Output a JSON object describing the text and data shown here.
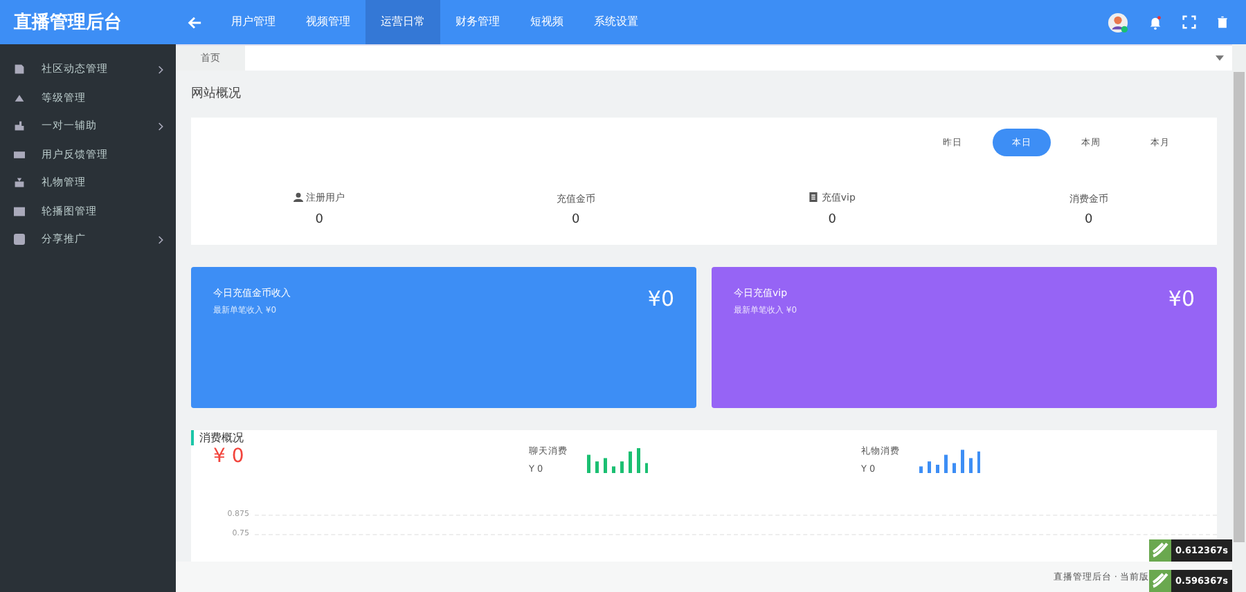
{
  "brand": "直播管理后台",
  "nav": [
    {
      "label": "用户管理",
      "selected": false
    },
    {
      "label": "视频管理",
      "selected": false
    },
    {
      "label": "运营日常",
      "selected": true
    },
    {
      "label": "财务管理",
      "selected": false
    },
    {
      "label": "短视频",
      "selected": false
    },
    {
      "label": "系统设置",
      "selected": false
    }
  ],
  "sidebar": [
    {
      "label": "社区动态管理",
      "kind": "doc",
      "has_children": true
    },
    {
      "label": "等级管理",
      "kind": "tri",
      "has_children": false
    },
    {
      "label": "一对一辅助",
      "kind": "hand",
      "has_children": true
    },
    {
      "label": "用户反馈管理",
      "kind": "list",
      "has_children": false
    },
    {
      "label": "礼物管理",
      "kind": "gift",
      "has_children": false
    },
    {
      "label": "轮播图管理",
      "kind": "image",
      "has_children": false
    },
    {
      "label": "分享推广",
      "kind": "share",
      "has_children": true
    }
  ],
  "tabs": [
    {
      "label": "首页",
      "selected": true
    }
  ],
  "section_title": "网站概况",
  "periods": [
    {
      "label": "昨日",
      "selected": false
    },
    {
      "label": "本日",
      "selected": true
    },
    {
      "label": "本周",
      "selected": false
    },
    {
      "label": "本月",
      "selected": false
    }
  ],
  "stats": [
    {
      "label": "注册用户",
      "value": "0",
      "kind": "user"
    },
    {
      "label": "充值金币",
      "value": "0",
      "kind": "plain"
    },
    {
      "label": "充值vip",
      "value": "0",
      "kind": "book"
    },
    {
      "label": "消费金币",
      "value": "0",
      "kind": "plain"
    }
  ],
  "income_cards": [
    {
      "title": "今日充值金币收入",
      "subtitle": "最新单笔收入 ¥0",
      "amount": "¥0",
      "color": "#3d8ef5"
    },
    {
      "title": "今日充值vip",
      "subtitle": "最新单笔收入 ¥0",
      "amount": "¥0",
      "color": "#9664f5"
    }
  ],
  "consumption": {
    "title": "消费概况",
    "total": "¥ 0",
    "items": [
      {
        "label": "聊天消费",
        "value": "Y 0",
        "color": "#1bbf72"
      },
      {
        "label": "礼物消费",
        "value": "Y 0",
        "color": "#3d8ef5"
      }
    ],
    "axis_labels": [
      "0.875",
      "0.75"
    ]
  },
  "footer": "直播管理后台 · 当前版",
  "timers": [
    "0.612367s",
    "0.596367s"
  ]
}
